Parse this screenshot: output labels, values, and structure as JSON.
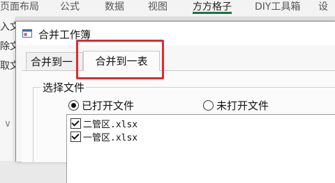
{
  "ribbon": {
    "tabs": [
      "页面布局",
      "公式",
      "数据",
      "视图",
      "方方格子",
      "DIY工具箱",
      "设"
    ],
    "left_fragments": [
      "入文",
      "除文",
      "取文"
    ]
  },
  "dialog": {
    "title": "合并工作簿",
    "tabs": [
      "合并到一簿",
      "合并到一表"
    ],
    "active_tab": 1,
    "group_label": "选择文件",
    "radio_opened": "已打开文件",
    "radio_unopened": "未打开文件",
    "selected_radio": "已打开文件",
    "files": [
      {
        "checked": true,
        "name": "二管区.xlsx"
      },
      {
        "checked": true,
        "name": "一管区.xlsx"
      }
    ]
  },
  "colors": {
    "highlight": "#e0292e",
    "ribbon_accent": "#1e7145"
  }
}
